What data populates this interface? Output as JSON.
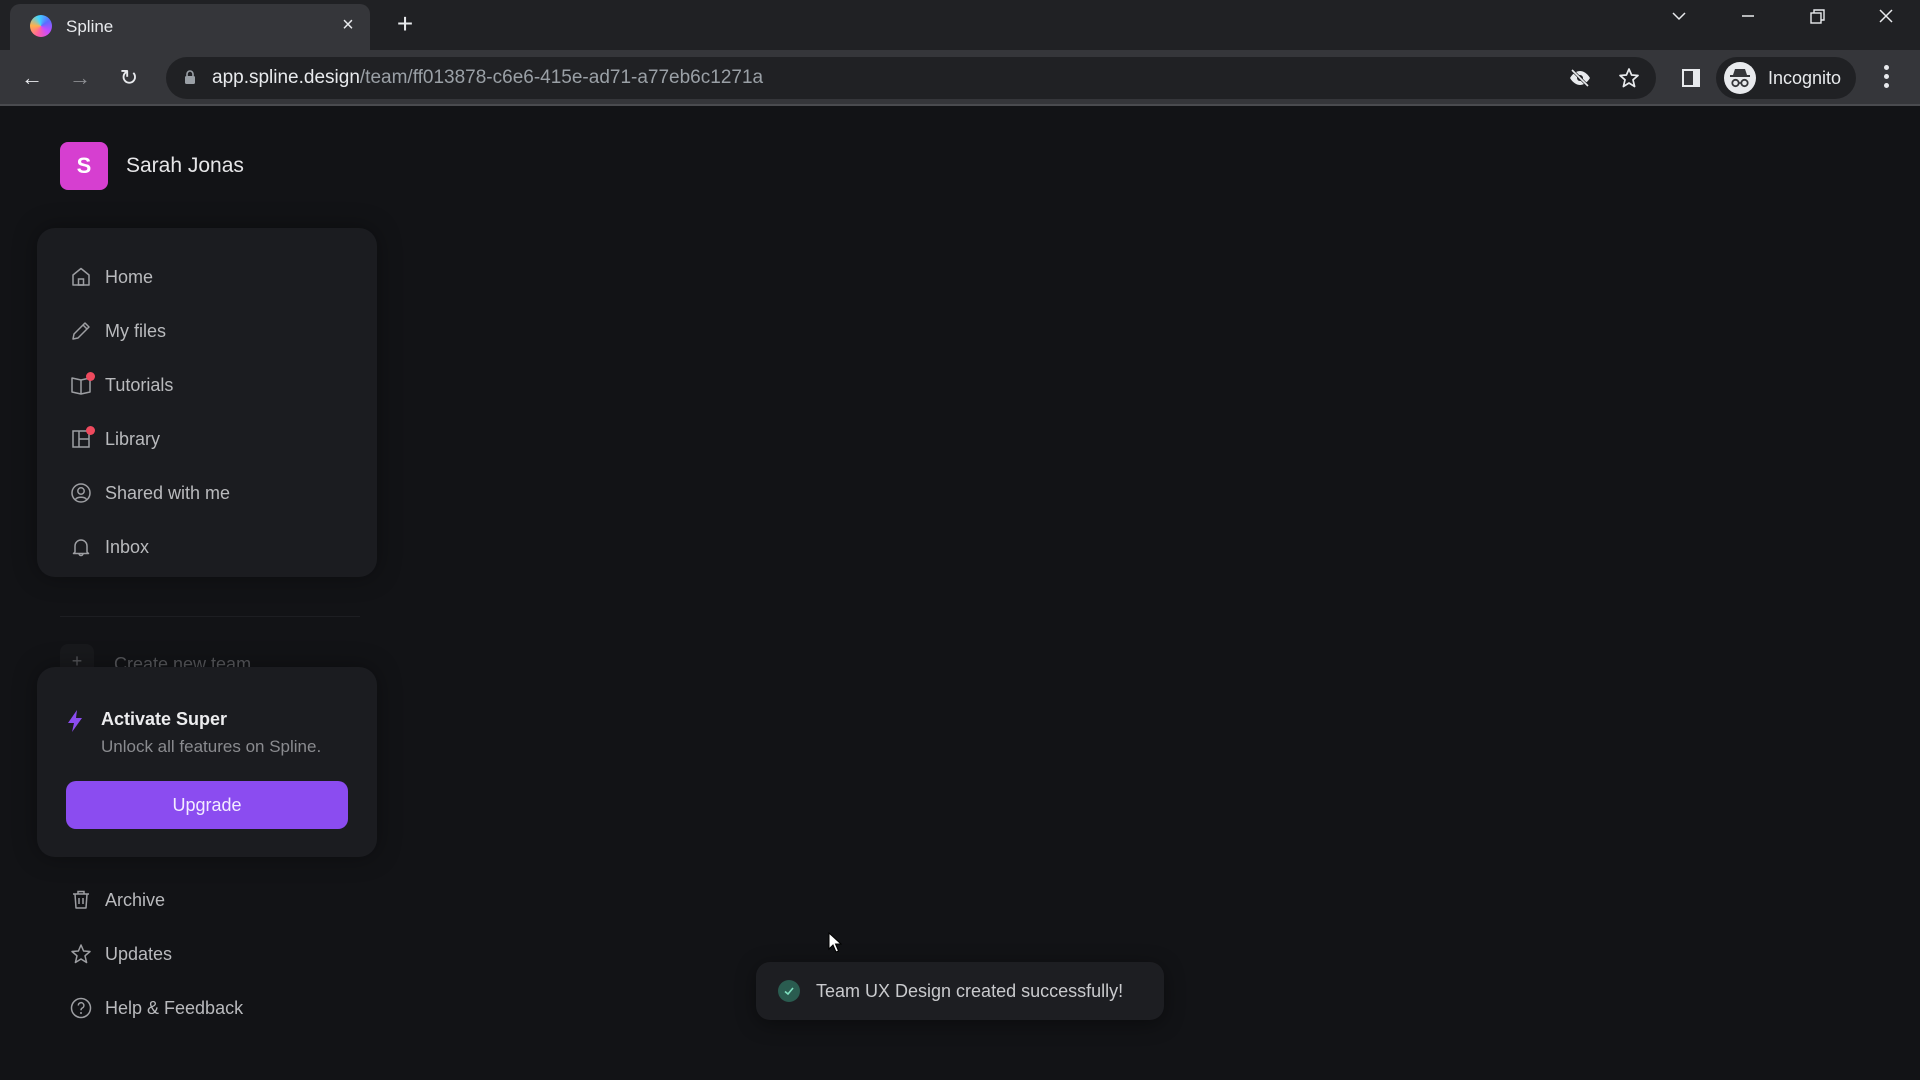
{
  "browser": {
    "tab": {
      "title": "Spline",
      "close_glyph": "×"
    },
    "new_tab_glyph": "+",
    "window_controls": {
      "tab_search_glyph": "⌵",
      "minimize_glyph": "—",
      "restore_glyph": "❐",
      "close_glyph": "✕"
    },
    "nav": {
      "back_glyph": "←",
      "forward_glyph": "→",
      "reload_glyph": "↻"
    },
    "url": {
      "host": "app.spline.design",
      "path": "/team/ff013878-c6e6-415e-ad71-a77eb6c1271a"
    },
    "profile_label": "Incognito"
  },
  "user": {
    "initial": "S",
    "name": "Sarah Jonas",
    "avatar_color": "#d63fd0"
  },
  "sidebar": {
    "items": [
      {
        "label": "Home",
        "icon": "home-icon",
        "badge": false
      },
      {
        "label": "My files",
        "icon": "pencil-icon",
        "badge": false
      },
      {
        "label": "Tutorials",
        "icon": "book-icon",
        "badge": true
      },
      {
        "label": "Library",
        "icon": "library-icon",
        "badge": true
      },
      {
        "label": "Shared with me",
        "icon": "user-circle-icon",
        "badge": false
      },
      {
        "label": "Inbox",
        "icon": "bell-icon",
        "badge": false
      }
    ],
    "create_team_label": "Create new team",
    "bottom_items": [
      {
        "label": "Archive",
        "icon": "trash-icon"
      },
      {
        "label": "Updates",
        "icon": "star-icon"
      },
      {
        "label": "Help & Feedback",
        "icon": "help-circle-icon"
      }
    ]
  },
  "upgrade": {
    "title": "Activate Super",
    "subtitle": "Unlock all features on Spline.",
    "button_label": "Upgrade",
    "accent_color": "#8b4cf0"
  },
  "toast": {
    "message": "Team UX Design created successfully!",
    "status": "success"
  }
}
